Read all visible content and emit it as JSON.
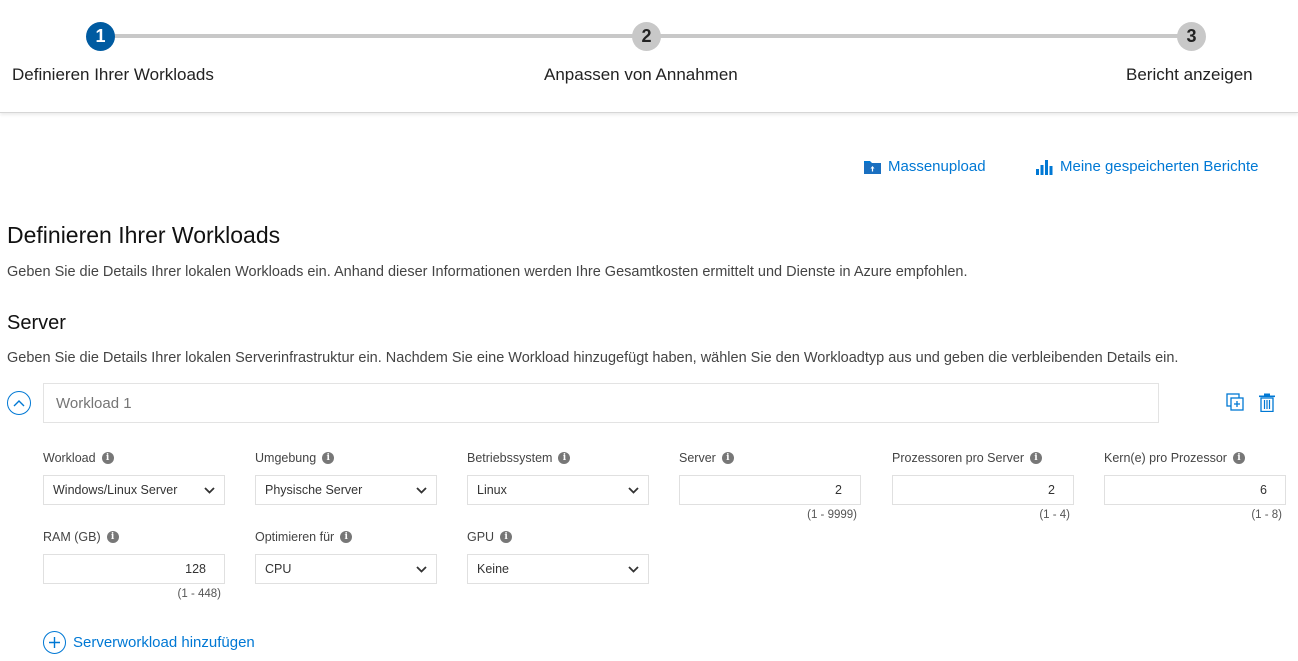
{
  "stepper": {
    "steps": [
      {
        "number": "1",
        "label": "Definieren Ihrer Workloads",
        "state": "active"
      },
      {
        "number": "2",
        "label": "Anpassen von Annahmen",
        "state": "inactive"
      },
      {
        "number": "3",
        "label": "Bericht anzeigen",
        "state": "inactive"
      }
    ]
  },
  "links": {
    "bulk_upload": {
      "label": "Massenupload",
      "icon": "folder-upload-icon"
    },
    "saved_reports": {
      "label": "Meine gespeicherten Berichte",
      "icon": "bar-chart-icon"
    }
  },
  "page": {
    "title": "Definieren Ihrer Workloads",
    "description": "Geben Sie die Details Ihrer lokalen Workloads ein. Anhand dieser Informationen werden Ihre Gesamtkosten ermittelt und Dienste in Azure empfohlen."
  },
  "server_section": {
    "title": "Server",
    "description": "Geben Sie die Details Ihrer lokalen Serverinfrastruktur ein. Nachdem Sie eine Workload hinzugefügt haben, wählen Sie den Workloadtyp aus und geben die verbleibenden Details ein."
  },
  "workload": {
    "name_placeholder": "Workload 1",
    "fields": {
      "workload": {
        "label": "Workload",
        "value": "Windows/Linux Server"
      },
      "environment": {
        "label": "Umgebung",
        "value": "Physische Server"
      },
      "os": {
        "label": "Betriebssystem",
        "value": "Linux"
      },
      "servers": {
        "label": "Server",
        "value": "2",
        "range": "(1 - 9999)"
      },
      "procs": {
        "label": "Prozessoren pro Server",
        "value": "2",
        "range": "(1 - 4)"
      },
      "cores": {
        "label": "Kern(e) pro Prozessor",
        "value": "6",
        "range": "(1 - 8)"
      },
      "ram": {
        "label": "RAM (GB)",
        "value": "128",
        "range": "(1 - 448)"
      },
      "optimize": {
        "label": "Optimieren für",
        "value": "CPU"
      },
      "gpu": {
        "label": "GPU",
        "value": "Keine"
      }
    }
  },
  "add_workload": {
    "label": "Serverworkload hinzufügen"
  },
  "info_glyph": "i",
  "colors": {
    "accent": "#0078d4",
    "step_active": "#005ba1",
    "step_inactive": "#c8c8c8"
  }
}
